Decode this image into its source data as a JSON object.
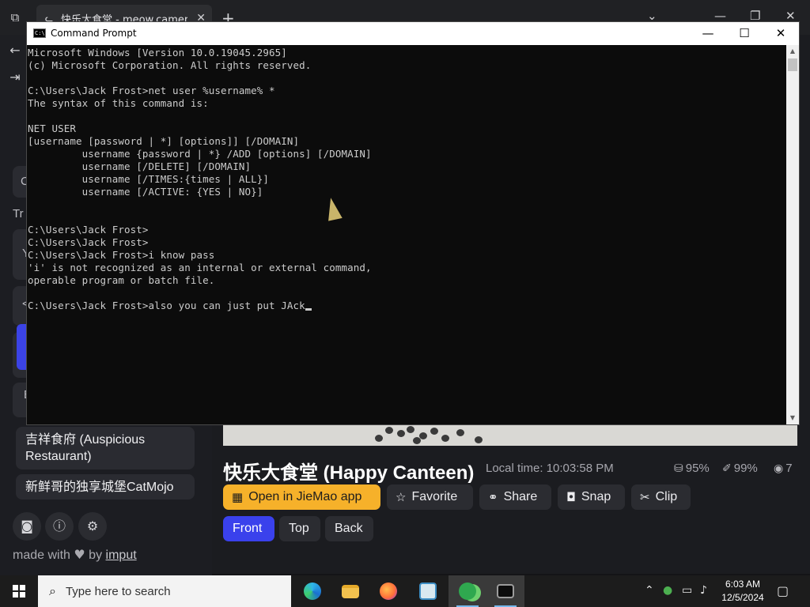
{
  "browser": {
    "tab_title": "快乐大食堂 - meow.camera",
    "tab_close": "✕",
    "new_tab": "+",
    "controls": {
      "dropdown": "⌄",
      "minimize": "—",
      "restore": "❐",
      "close": "✕"
    }
  },
  "sidebar": {
    "fragments": {
      "search": "C",
      "label_tr": "Tr",
      "card1": "Y",
      "card2": "<",
      "card3": "E"
    },
    "items": [
      {
        "label": "吉祥食府 (Auspicious Restaurant)"
      },
      {
        "label": "新鲜哥的独享城堡CatMojo"
      }
    ],
    "footer_buttons": [
      "discord-icon",
      "info-icon",
      "gear-icon"
    ],
    "made_with": {
      "prefix": "made with",
      "heart": "♥",
      "by": "by",
      "link": "imput"
    }
  },
  "camera": {
    "title": "快乐大食堂 (Happy Canteen)",
    "local_time": "Local time: 10:03:58 PM",
    "stats": {
      "food": "95%",
      "cleanliness": "99%",
      "viewers": "7"
    },
    "actions": {
      "open_app": "Open in JieMao app",
      "favorite": "Favorite",
      "share": "Share",
      "snap": "Snap",
      "clip": "Clip"
    },
    "views": {
      "front": "Front",
      "top": "Top",
      "back": "Back"
    }
  },
  "cmd": {
    "title": "Command Prompt",
    "controls": {
      "minimize": "—",
      "maximize": "☐",
      "close": "✕"
    },
    "lines": [
      "Microsoft Windows [Version 10.0.19045.2965]",
      "(c) Microsoft Corporation. All rights reserved.",
      "",
      "C:\\Users\\Jack Frost>net user %username% *",
      "The syntax of this command is:",
      "",
      "NET USER",
      "[username [password | *] [options]] [/DOMAIN]",
      "         username {password | *} /ADD [options] [/DOMAIN]",
      "         username [/DELETE] [/DOMAIN]",
      "         username [/TIMES:{times | ALL}]",
      "         username [/ACTIVE: {YES | NO}]",
      "",
      "",
      "C:\\Users\\Jack Frost>",
      "C:\\Users\\Jack Frost>",
      "C:\\Users\\Jack Frost>i know pass",
      "'i' is not recognized as an internal or external command,",
      "operable program or batch file.",
      "",
      "C:\\Users\\Jack Frost>also you can just put JAck"
    ]
  },
  "taskbar": {
    "search_placeholder": "Type here to search",
    "apps": [
      "edge-icon",
      "file-explorer-icon",
      "firefox-icon",
      "notepad-icon",
      "people-app-icon",
      "command-prompt-icon"
    ],
    "clock_time": "6:03 AM",
    "clock_date": "12/5/2024"
  }
}
